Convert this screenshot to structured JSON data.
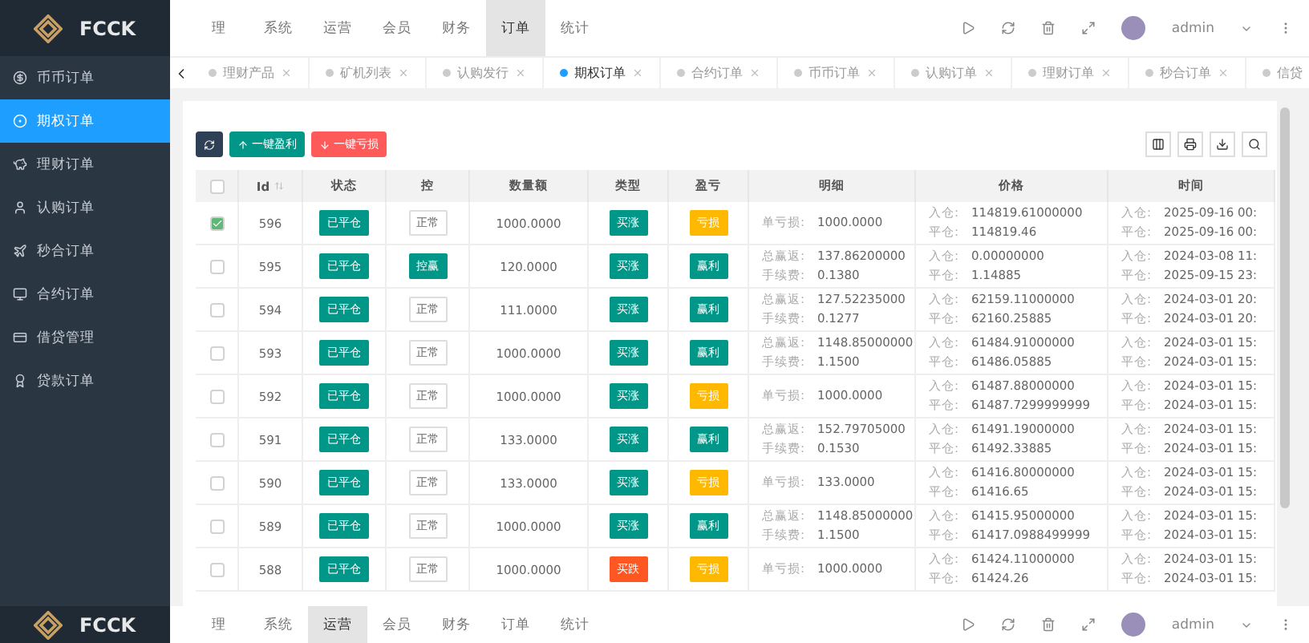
{
  "brand": {
    "name": "FCCK"
  },
  "header": {
    "nav": [
      {
        "label": "理",
        "selected": false
      },
      {
        "label": "系统",
        "selected": false
      },
      {
        "label": "运营",
        "selected": false
      },
      {
        "label": "会员",
        "selected": false
      },
      {
        "label": "财务",
        "selected": false
      },
      {
        "label": "订单",
        "selected": true
      },
      {
        "label": "统计",
        "selected": false
      }
    ],
    "user": "admin"
  },
  "sidebar": {
    "items": [
      {
        "label": "币币订单",
        "selected": false
      },
      {
        "label": "期权订单",
        "selected": true
      },
      {
        "label": "理财订单",
        "selected": false
      },
      {
        "label": "认购订单",
        "selected": false
      },
      {
        "label": "秒合订单",
        "selected": false
      },
      {
        "label": "合约订单",
        "selected": false
      },
      {
        "label": "借贷管理",
        "selected": false
      },
      {
        "label": "贷款订单",
        "selected": false
      }
    ]
  },
  "tabs": [
    {
      "label": "理财产品",
      "selected": false,
      "closable": true
    },
    {
      "label": "矿机列表",
      "selected": false,
      "closable": true
    },
    {
      "label": "认购发行",
      "selected": false,
      "closable": true
    },
    {
      "label": "期权订单",
      "selected": true,
      "closable": true
    },
    {
      "label": "合约订单",
      "selected": false,
      "closable": true
    },
    {
      "label": "币币订单",
      "selected": false,
      "closable": true
    },
    {
      "label": "认购订单",
      "selected": false,
      "closable": true
    },
    {
      "label": "理财订单",
      "selected": false,
      "closable": true
    },
    {
      "label": "秒合订单",
      "selected": false,
      "closable": true
    },
    {
      "label": "信贷",
      "selected": false,
      "closable": false
    }
  ],
  "toolbar": {
    "profit_button": "一键盈利",
    "loss_button": "一键亏损"
  },
  "table": {
    "select_all_checked": false,
    "columns": [
      "Id",
      "状态",
      "控",
      "数量额",
      "类型",
      "盈亏",
      "明细",
      "价格",
      "时间"
    ],
    "rows": [
      {
        "checked": true,
        "id": "596",
        "status": "已平仓",
        "control": {
          "text": "正常",
          "kind": "plain"
        },
        "amount": "1000.0000",
        "type": {
          "text": "买涨",
          "kind": "up"
        },
        "pnl": {
          "text": "亏损",
          "kind": "loss"
        },
        "detail": [
          {
            "label": "单亏损:",
            "value": "1000.0000"
          }
        ],
        "price": [
          {
            "label": "入仓:",
            "value": "114819.61000000"
          },
          {
            "label": "平仓:",
            "value": "114819.46"
          }
        ],
        "time": [
          {
            "label": "入仓:",
            "value": "2025-09-16 00:"
          },
          {
            "label": "平仓:",
            "value": "2025-09-16 00:"
          }
        ]
      },
      {
        "checked": false,
        "id": "595",
        "status": "已平仓",
        "control": {
          "text": "控赢",
          "kind": "tag"
        },
        "amount": "120.0000",
        "type": {
          "text": "买涨",
          "kind": "up"
        },
        "pnl": {
          "text": "赢利",
          "kind": "profit"
        },
        "detail": [
          {
            "label": "总赢返:",
            "value": "137.86200000"
          },
          {
            "label": "手续费:",
            "value": "0.1380"
          }
        ],
        "price": [
          {
            "label": "入仓:",
            "value": "0.00000000"
          },
          {
            "label": "平仓:",
            "value": "1.14885"
          }
        ],
        "time": [
          {
            "label": "入仓:",
            "value": "2024-03-08 11:"
          },
          {
            "label": "平仓:",
            "value": "2025-09-15 23:"
          }
        ]
      },
      {
        "checked": false,
        "id": "594",
        "status": "已平仓",
        "control": {
          "text": "正常",
          "kind": "plain"
        },
        "amount": "111.0000",
        "type": {
          "text": "买涨",
          "kind": "up"
        },
        "pnl": {
          "text": "赢利",
          "kind": "profit"
        },
        "detail": [
          {
            "label": "总赢返:",
            "value": "127.52235000"
          },
          {
            "label": "手续费:",
            "value": "0.1277"
          }
        ],
        "price": [
          {
            "label": "入仓:",
            "value": "62159.11000000"
          },
          {
            "label": "平仓:",
            "value": "62160.25885"
          }
        ],
        "time": [
          {
            "label": "入仓:",
            "value": "2024-03-01 20:"
          },
          {
            "label": "平仓:",
            "value": "2024-03-01 20:"
          }
        ]
      },
      {
        "checked": false,
        "id": "593",
        "status": "已平仓",
        "control": {
          "text": "正常",
          "kind": "plain"
        },
        "amount": "1000.0000",
        "type": {
          "text": "买涨",
          "kind": "up"
        },
        "pnl": {
          "text": "赢利",
          "kind": "profit"
        },
        "detail": [
          {
            "label": "总赢返:",
            "value": "1148.85000000"
          },
          {
            "label": "手续费:",
            "value": "1.1500"
          }
        ],
        "price": [
          {
            "label": "入仓:",
            "value": "61484.91000000"
          },
          {
            "label": "平仓:",
            "value": "61486.05885"
          }
        ],
        "time": [
          {
            "label": "入仓:",
            "value": "2024-03-01 15:"
          },
          {
            "label": "平仓:",
            "value": "2024-03-01 15:"
          }
        ]
      },
      {
        "checked": false,
        "id": "592",
        "status": "已平仓",
        "control": {
          "text": "正常",
          "kind": "plain"
        },
        "amount": "1000.0000",
        "type": {
          "text": "买涨",
          "kind": "up"
        },
        "pnl": {
          "text": "亏损",
          "kind": "loss"
        },
        "detail": [
          {
            "label": "单亏损:",
            "value": "1000.0000"
          }
        ],
        "price": [
          {
            "label": "入仓:",
            "value": "61487.88000000"
          },
          {
            "label": "平仓:",
            "value": "61487.7299999999"
          }
        ],
        "time": [
          {
            "label": "入仓:",
            "value": "2024-03-01 15:"
          },
          {
            "label": "平仓:",
            "value": "2024-03-01 15:"
          }
        ]
      },
      {
        "checked": false,
        "id": "591",
        "status": "已平仓",
        "control": {
          "text": "正常",
          "kind": "plain"
        },
        "amount": "133.0000",
        "type": {
          "text": "买涨",
          "kind": "up"
        },
        "pnl": {
          "text": "赢利",
          "kind": "profit"
        },
        "detail": [
          {
            "label": "总赢返:",
            "value": "152.79705000"
          },
          {
            "label": "手续费:",
            "value": "0.1530"
          }
        ],
        "price": [
          {
            "label": "入仓:",
            "value": "61491.19000000"
          },
          {
            "label": "平仓:",
            "value": "61492.33885"
          }
        ],
        "time": [
          {
            "label": "入仓:",
            "value": "2024-03-01 15:"
          },
          {
            "label": "平仓:",
            "value": "2024-03-01 15:"
          }
        ]
      },
      {
        "checked": false,
        "id": "590",
        "status": "已平仓",
        "control": {
          "text": "正常",
          "kind": "plain"
        },
        "amount": "133.0000",
        "type": {
          "text": "买涨",
          "kind": "up"
        },
        "pnl": {
          "text": "亏损",
          "kind": "loss"
        },
        "detail": [
          {
            "label": "单亏损:",
            "value": "133.0000"
          }
        ],
        "price": [
          {
            "label": "入仓:",
            "value": "61416.80000000"
          },
          {
            "label": "平仓:",
            "value": "61416.65"
          }
        ],
        "time": [
          {
            "label": "入仓:",
            "value": "2024-03-01 15:"
          },
          {
            "label": "平仓:",
            "value": "2024-03-01 15:"
          }
        ]
      },
      {
        "checked": false,
        "id": "589",
        "status": "已平仓",
        "control": {
          "text": "正常",
          "kind": "plain"
        },
        "amount": "1000.0000",
        "type": {
          "text": "买涨",
          "kind": "up"
        },
        "pnl": {
          "text": "赢利",
          "kind": "profit"
        },
        "detail": [
          {
            "label": "总赢返:",
            "value": "1148.85000000"
          },
          {
            "label": "手续费:",
            "value": "1.1500"
          }
        ],
        "price": [
          {
            "label": "入仓:",
            "value": "61415.95000000"
          },
          {
            "label": "平仓:",
            "value": "61417.0988499999"
          }
        ],
        "time": [
          {
            "label": "入仓:",
            "value": "2024-03-01 15:"
          },
          {
            "label": "平仓:",
            "value": "2024-03-01 15:"
          }
        ]
      },
      {
        "checked": false,
        "id": "588",
        "status": "已平仓",
        "control": {
          "text": "正常",
          "kind": "plain"
        },
        "amount": "1000.0000",
        "type": {
          "text": "买跌",
          "kind": "down"
        },
        "pnl": {
          "text": "亏损",
          "kind": "loss"
        },
        "detail": [
          {
            "label": "单亏损:",
            "value": "1000.0000"
          }
        ],
        "price": [
          {
            "label": "入仓:",
            "value": "61424.11000000"
          },
          {
            "label": "平仓:",
            "value": "61424.26"
          }
        ],
        "time": [
          {
            "label": "入仓:",
            "value": "2024-03-01 15:"
          },
          {
            "label": "平仓:",
            "value": "2024-03-01 15:"
          }
        ]
      }
    ]
  },
  "bottom_header": {
    "brand": "FCCK",
    "nav": [
      {
        "label": "理",
        "selected": false
      },
      {
        "label": "系统",
        "selected": false
      },
      {
        "label": "运营",
        "selected": true
      },
      {
        "label": "会员",
        "selected": false
      },
      {
        "label": "财务",
        "selected": false
      },
      {
        "label": "订单",
        "selected": false
      },
      {
        "label": "统计",
        "selected": false
      }
    ],
    "user": "admin"
  }
}
